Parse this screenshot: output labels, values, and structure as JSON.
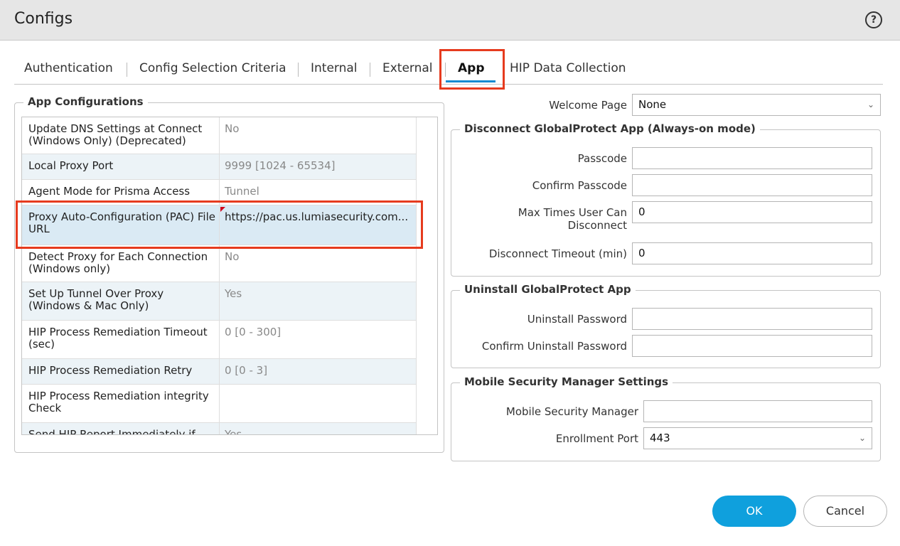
{
  "dialog": {
    "title": "Configs"
  },
  "tabs": [
    {
      "label": "Authentication"
    },
    {
      "label": "Config Selection Criteria"
    },
    {
      "label": "Internal"
    },
    {
      "label": "External"
    },
    {
      "label": "App"
    },
    {
      "label": "HIP Data Collection"
    }
  ],
  "active_tab": "App",
  "app_config": {
    "legend": "App Configurations",
    "rows": [
      {
        "label": "Update DNS Settings at Connect (Windows Only) (Deprecated)",
        "value": "No"
      },
      {
        "label": "Local Proxy Port",
        "value": "9999 [1024 - 65534]"
      },
      {
        "label": "Agent Mode for Prisma Access",
        "value": "Tunnel"
      },
      {
        "label": "Proxy Auto-Configuration (PAC) File URL",
        "value": "https://pac.us.lumiasecurity.com..."
      },
      {
        "label": "Detect Proxy for Each Connection (Windows only)",
        "value": "No"
      },
      {
        "label": "Set Up Tunnel Over Proxy (Windows & Mac Only)",
        "value": "Yes"
      },
      {
        "label": "HIP Process Remediation Timeout (sec)",
        "value": "0 [0 - 300]"
      },
      {
        "label": "HIP Process Remediation Retry",
        "value": "0 [0 - 3]"
      },
      {
        "label": "HIP Process Remediation integrity Check",
        "value": ""
      },
      {
        "label": "Send HIP Report Immediately if",
        "value": "Yes"
      }
    ]
  },
  "welcome": {
    "label": "Welcome Page",
    "value": "None"
  },
  "disconnect": {
    "legend": "Disconnect GlobalProtect App (Always-on mode)",
    "passcode_label": "Passcode",
    "passcode_value": "",
    "confirm_label": "Confirm Passcode",
    "confirm_value": "",
    "max_label": "Max Times User Can Disconnect",
    "max_value": "0",
    "timeout_label": "Disconnect Timeout (min)",
    "timeout_value": "0"
  },
  "uninstall": {
    "legend": "Uninstall GlobalProtect App",
    "password_label": "Uninstall Password",
    "password_value": "",
    "confirm_label": "Confirm Uninstall Password",
    "confirm_value": ""
  },
  "msm": {
    "legend": "Mobile Security Manager Settings",
    "manager_label": "Mobile Security Manager",
    "manager_value": "",
    "port_label": "Enrollment Port",
    "port_value": "443"
  },
  "buttons": {
    "ok": "OK",
    "cancel": "Cancel"
  },
  "colors": {
    "accent": "#0fa0dd",
    "highlight": "#e63b1e",
    "row_alt": "#ecf3f7",
    "dirty_flag": "#d0021b"
  }
}
